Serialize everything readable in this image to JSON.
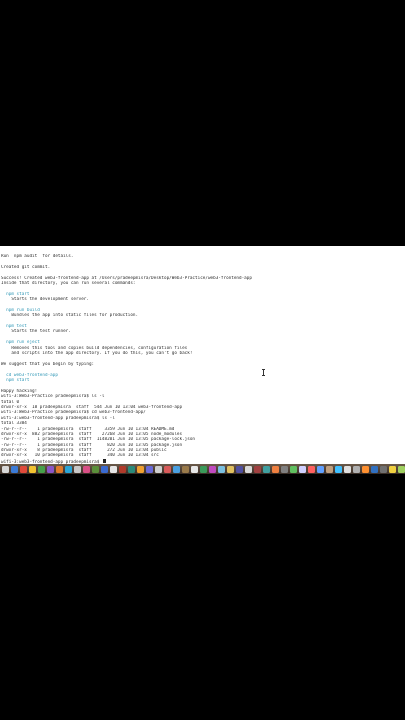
{
  "terminal": {
    "lines": [
      {
        "text": "Run `npm audit` for details.",
        "style": ""
      },
      {
        "text": "",
        "style": ""
      },
      {
        "text": "Created git commit.",
        "style": ""
      },
      {
        "text": "",
        "style": ""
      },
      {
        "text": "Success! Created web3-frontend-app at /Users/pradeepmisra/Desktop/Web3-Practice/web3-frontend-app",
        "style": ""
      },
      {
        "text": "Inside that directory, you can run several commands:",
        "style": ""
      },
      {
        "text": "",
        "style": ""
      },
      {
        "text": "  npm start",
        "style": "cyan"
      },
      {
        "text": "    Starts the development server.",
        "style": ""
      },
      {
        "text": "",
        "style": ""
      },
      {
        "text": "  npm run build",
        "style": "cyan"
      },
      {
        "text": "    Bundles the app into static files for production.",
        "style": ""
      },
      {
        "text": "",
        "style": ""
      },
      {
        "text": "  npm test",
        "style": "cyan"
      },
      {
        "text": "    Starts the test runner.",
        "style": ""
      },
      {
        "text": "",
        "style": ""
      },
      {
        "text": "  npm run eject",
        "style": "cyan"
      },
      {
        "text": "    Removes this tool and copies build dependencies, configuration files",
        "style": ""
      },
      {
        "text": "    and scripts into the app directory. If you do this, you can't go back!",
        "style": ""
      },
      {
        "text": "",
        "style": ""
      },
      {
        "text": "We suggest that you begin by typing:",
        "style": ""
      },
      {
        "text": "",
        "style": ""
      },
      {
        "text": "  cd web3-frontend-app",
        "style": "cyan"
      },
      {
        "text": "  npm start",
        "style": "cyan"
      },
      {
        "text": "",
        "style": ""
      },
      {
        "text": "Happy hacking!",
        "style": ""
      },
      {
        "text": "wifi-3:Web3-Practice pradeepmisra$ ls -l",
        "style": ""
      },
      {
        "text": "total 0",
        "style": ""
      },
      {
        "text": "drwxr-xr-x  18 pradeepmisra  staff  544 Jun 10 13:04 web3-frontend-app",
        "style": ""
      },
      {
        "text": "wifi-3:Web3-Practice pradeepmisra$ cd web3-frontend-app/",
        "style": ""
      },
      {
        "text": "wifi-3:web3-frontend-app pradeepmisra$ ls -l",
        "style": ""
      },
      {
        "text": "total 3384",
        "style": ""
      },
      {
        "text": "-rw-r--r--    1 pradeepmisra  staff     3359 Jun 10 13:04 README.md",
        "style": ""
      },
      {
        "text": "drwxr-xr-x  882 pradeepmisra  staff    27268 Jun 10 13:05 node_modules",
        "style": ""
      },
      {
        "text": "-rw-r--r--    1 pradeepmisra  staff  1148201 Jun 10 13:05 package-lock.json",
        "style": ""
      },
      {
        "text": "-rw-r--r--    1 pradeepmisra  staff      820 Jun 10 13:05 package.json",
        "style": ""
      },
      {
        "text": "drwxr-xr-x    8 pradeepmisra  staff      272 Jun 10 13:04 public",
        "style": ""
      },
      {
        "text": "drwxr-xr-x   10 pradeepmisra  staff      340 Jun 10 13:04 src",
        "style": ""
      }
    ],
    "prompt": "wifi-3:web3-frontend-app pradeepmisra$ "
  },
  "dock": {
    "icon_colors": [
      "#d8d8d8",
      "#3b7bd6",
      "#e04a3a",
      "#f2c230",
      "#46a04a",
      "#8a55c8",
      "#e07a2a",
      "#2aa6d8",
      "#c8c8c8",
      "#d94f86",
      "#5a8f3a",
      "#3a6ad0",
      "#e6e6e6",
      "#b03a2a",
      "#2a8a7a",
      "#f0a030",
      "#6a6ad8",
      "#cfcfcf",
      "#d85a5a",
      "#4aa0e0",
      "#9a7a4a",
      "#e8e8e8",
      "#3a9a5a",
      "#c04ac0",
      "#7ac0e0",
      "#e0c060",
      "#5050a0",
      "#dadada",
      "#a04040",
      "#40a0a0",
      "#f08040",
      "#808080",
      "#60c060",
      "#d0d0ff",
      "#ff6060",
      "#60a0ff",
      "#c0a080",
      "#40c0ff",
      "#e0e0e0",
      "#b0b0b0",
      "#ff9030",
      "#3070c0",
      "#707070",
      "#f0d040",
      "#a0d060",
      "#d060a0",
      "#60d0c0",
      "#9090ff",
      "#ffb0b0",
      "#b0ffb0",
      "#ffd0a0"
    ]
  }
}
